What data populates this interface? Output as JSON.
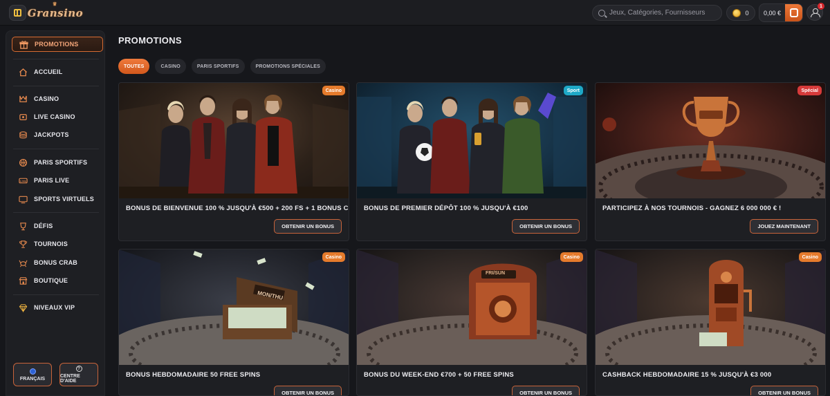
{
  "header": {
    "logo_text": "Gransino",
    "search_placeholder": "Jeux, Catégories, Fournisseurs",
    "coins": "0",
    "balance": "0,00 €",
    "notifications": "1"
  },
  "sidebar": {
    "items": [
      {
        "label": "PROMOTIONS",
        "icon": "gift-icon"
      },
      {
        "label": "ACCUEIL",
        "icon": "home-icon"
      },
      {
        "label": "CASINO",
        "icon": "casino-icon"
      },
      {
        "label": "LIVE CASINO",
        "icon": "live-casino-icon"
      },
      {
        "label": "JACKPOTS",
        "icon": "jackpots-icon"
      },
      {
        "label": "PARIS SPORTIFS",
        "icon": "ball-icon"
      },
      {
        "label": "PARIS LIVE",
        "icon": "live-icon"
      },
      {
        "label": "SPORTS VIRTUELS",
        "icon": "virtual-sports-icon"
      },
      {
        "label": "DÉFIS",
        "icon": "challenge-icon"
      },
      {
        "label": "TOURNOIS",
        "icon": "trophy-icon"
      },
      {
        "label": "BONUS CRAB",
        "icon": "crab-icon"
      },
      {
        "label": "BOUTIQUE",
        "icon": "shop-icon"
      },
      {
        "label": "NIVEAUX VIP",
        "icon": "diamond-icon"
      }
    ],
    "language_label": "FRANÇAIS",
    "help_label": "CENTRE D'AIDE"
  },
  "main": {
    "title": "PROMOTIONS",
    "tabs": [
      "TOUTES",
      "CASINO",
      "PARIS SPORTIFS",
      "PROMOTIONS SPÉCIALES"
    ],
    "cards": [
      {
        "badge": "Casino",
        "title": "BONUS DE BIENVENUE 100 % JUSQU'À €500 + 200 FS + 1 BONUS CRAB",
        "cta": "OBTENIR UN BONUS"
      },
      {
        "badge": "Sport",
        "title": "BONUS DE PREMIER DÉPÔT 100 % JUSQU'À €100",
        "cta": "OBTENIR UN BONUS"
      },
      {
        "badge": "Spécial",
        "title": "PARTICIPEZ À NOS TOURNOIS - GAGNEZ 6 000 000 € !",
        "cta": "JOUEZ MAINTENANT"
      },
      {
        "badge": "Casino",
        "title": "BONUS HEBDOMADAIRE 50 FREE SPINS",
        "cta": "OBTENIR UN BONUS",
        "sign": "MON/THU"
      },
      {
        "badge": "Casino",
        "title": "BONUS DU WEEK-END €700 + 50 FREE SPINS",
        "cta": "OBTENIR UN BONUS",
        "sign": "FRI/SUN"
      },
      {
        "badge": "Casino",
        "title": "CASHBACK HEBDOMADAIRE 15 % JUSQU'À €3 000",
        "cta": "OBTENIR UN BONUS"
      }
    ]
  },
  "colors": {
    "accent": "#e07a3c",
    "badge_casino": "#e57b2c",
    "badge_sport": "#1ea8c6",
    "badge_special": "#d63a3a"
  }
}
